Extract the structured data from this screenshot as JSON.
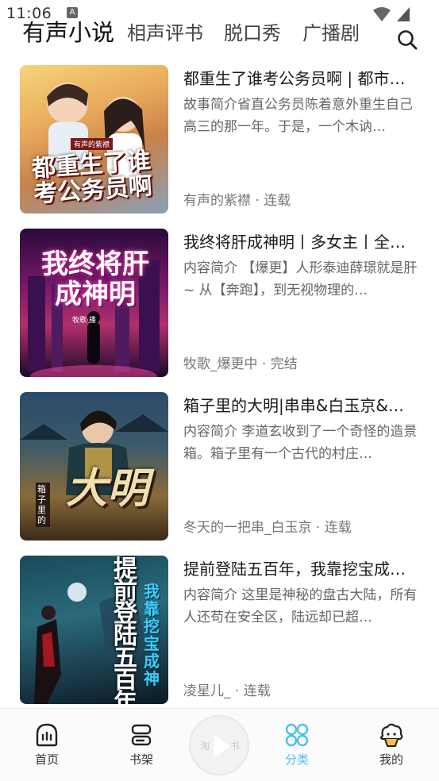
{
  "status_bar": {
    "time": "11:06",
    "notif_letter": "A"
  },
  "tabs": [
    {
      "label": "有声小说",
      "active": true
    },
    {
      "label": "相声评书",
      "active": false
    },
    {
      "label": "脱口秀",
      "active": false
    },
    {
      "label": "广播剧",
      "active": false
    }
  ],
  "books": [
    {
      "title": "都重生了谁考公务员啊 | 都市…",
      "desc": "故事简介省直公务员陈着意外重生自己高三的那一年。于是，一个木讷…",
      "author_status": "有声的紫襟 · 连载",
      "cover_text": "都重生了谁考公务员啊",
      "cover_badge": "有声的紫襟"
    },
    {
      "title": "我终将肝成神明丨多女主丨全…",
      "desc": "内容简介 【爆更】人形泰迪薛璟就是肝~ 从【奔跑】，到无视物理的…",
      "author_status": "牧歌_爆更中 · 完结",
      "cover_text": "我终将肝成神明",
      "cover_badge": "牧歌·播"
    },
    {
      "title": "箱子里的大明|串串&白玉京&…",
      "desc": "内容简介 李道玄收到了一个奇怪的造景箱。箱子里有一个古代的村庄…",
      "author_status": "冬天的一把串_白玉京 · 连载",
      "cover_text": "大明",
      "cover_badge": "箱子里的"
    },
    {
      "title": "提前登陆五百年，我靠挖宝成…",
      "desc": "内容简介 这里是神秘的盘古大陆，所有人还苟在安全区，陆远却已超…",
      "author_status": "凌星儿_ · 连载",
      "cover_text": "提前登陆五百年",
      "cover_badge": "我靠挖宝成神"
    }
  ],
  "bottom_nav": {
    "home": "首页",
    "shelf": "书架",
    "player_left": "淘",
    "player_right": "书",
    "category": "分类",
    "mine": "我的"
  },
  "colors": {
    "accent": "#4dc1e6"
  }
}
